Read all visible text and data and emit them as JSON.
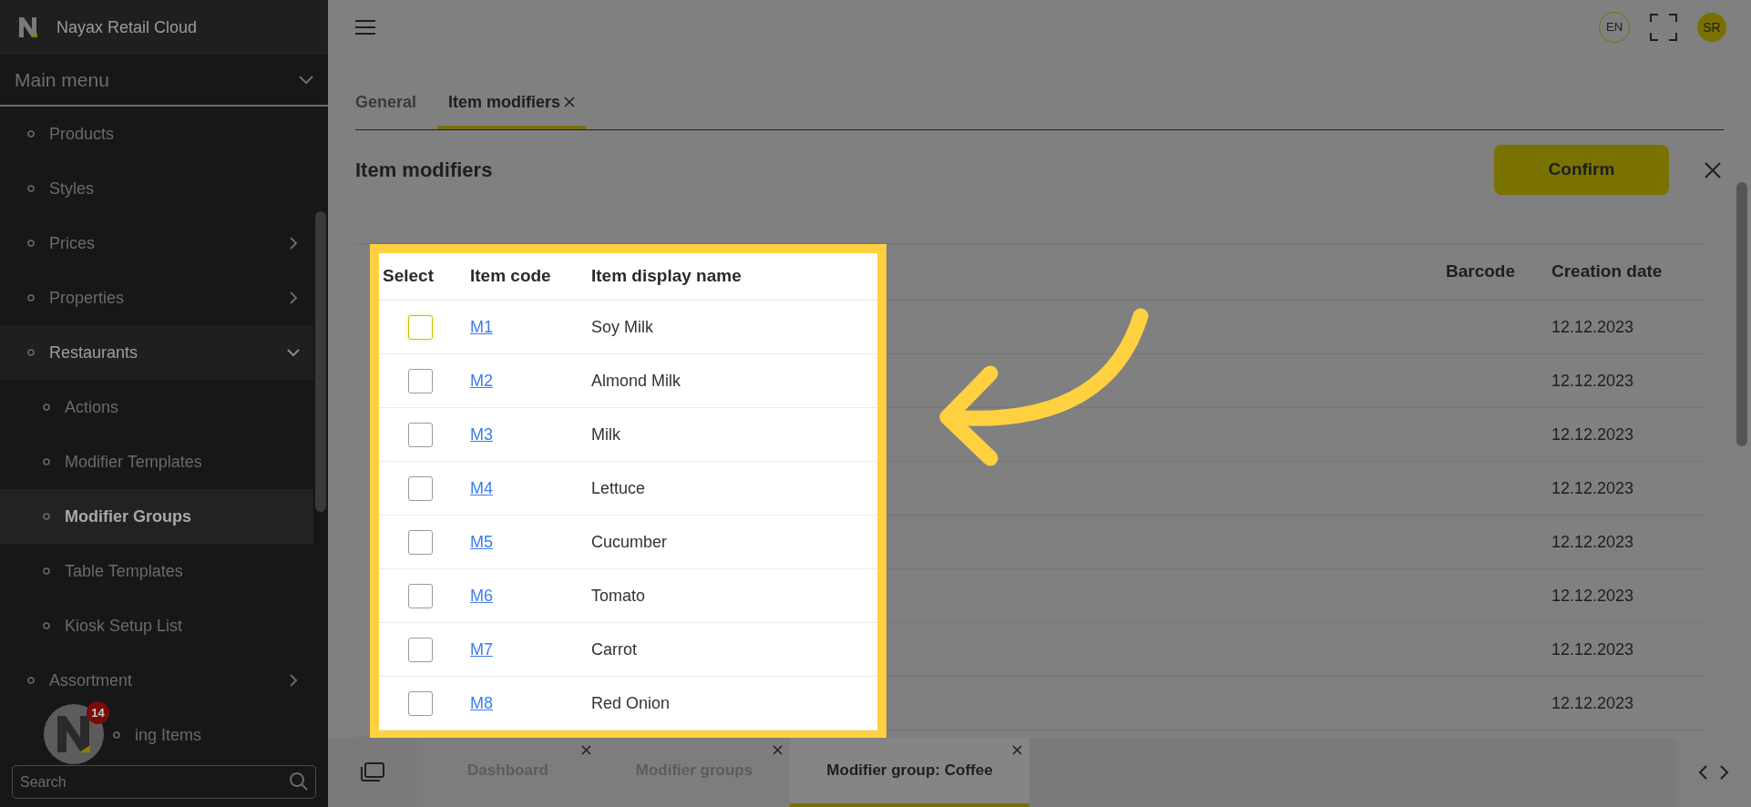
{
  "sidebar": {
    "brand": "Nayax Retail Cloud",
    "menu_title": "Main menu",
    "items": [
      {
        "label": "Products",
        "kind": "link",
        "selected": false
      },
      {
        "label": "Styles",
        "kind": "link",
        "selected": false
      },
      {
        "label": "Prices",
        "kind": "group",
        "expanded": false,
        "selected": false
      },
      {
        "label": "Properties",
        "kind": "group",
        "expanded": false,
        "selected": false
      },
      {
        "label": "Restaurants",
        "kind": "group",
        "expanded": true,
        "selected": false,
        "children": [
          {
            "label": "Actions",
            "kind": "link",
            "selected": false
          },
          {
            "label": "Modifier Templates",
            "kind": "link",
            "selected": false
          },
          {
            "label": "Modifier Groups",
            "kind": "link",
            "selected": true
          },
          {
            "label": "Table Templates",
            "kind": "link",
            "selected": false
          },
          {
            "label": "Kiosk Setup List",
            "kind": "link",
            "selected": false
          }
        ]
      },
      {
        "label": "Assortment",
        "kind": "group",
        "expanded": false,
        "selected": false
      },
      {
        "label": "ing Items",
        "kind": "link",
        "selected": false
      }
    ],
    "search": {
      "placeholder": "Search"
    },
    "help_badge": "14"
  },
  "header": {
    "language": "EN",
    "avatar": "SR"
  },
  "tabs": [
    {
      "label": "General",
      "selected": false,
      "closable": false
    },
    {
      "label": "Item modifiers",
      "selected": true,
      "closable": true
    }
  ],
  "panel": {
    "title": "Item modifiers",
    "confirm": "Confirm"
  },
  "table": {
    "columns": [
      "Select",
      "Item code",
      "Item display name",
      "Barcode",
      "Creation date"
    ],
    "rows": [
      {
        "checked": false,
        "focused": true,
        "code": "M1",
        "name": "Soy Milk",
        "date": "12.12.2023"
      },
      {
        "checked": false,
        "focused": false,
        "code": "M2",
        "name": "Almond Milk",
        "date": "12.12.2023"
      },
      {
        "checked": false,
        "focused": false,
        "code": "M3",
        "name": "Milk",
        "date": "12.12.2023"
      },
      {
        "checked": false,
        "focused": false,
        "code": "M4",
        "name": "Lettuce",
        "date": "12.12.2023"
      },
      {
        "checked": false,
        "focused": false,
        "code": "M5",
        "name": "Cucumber",
        "date": "12.12.2023"
      },
      {
        "checked": false,
        "focused": false,
        "code": "M6",
        "name": "Tomato",
        "date": "12.12.2023"
      },
      {
        "checked": false,
        "focused": false,
        "code": "M7",
        "name": "Carrot",
        "date": "12.12.2023"
      },
      {
        "checked": false,
        "focused": false,
        "code": "M8",
        "name": "Red Onion",
        "date": "12.12.2023"
      }
    ]
  },
  "bottom_tabs": [
    {
      "label": "Dashboard",
      "selected": false
    },
    {
      "label": "Modifier groups",
      "selected": false
    },
    {
      "label": "Modifier group: Coffee",
      "selected": true
    }
  ]
}
